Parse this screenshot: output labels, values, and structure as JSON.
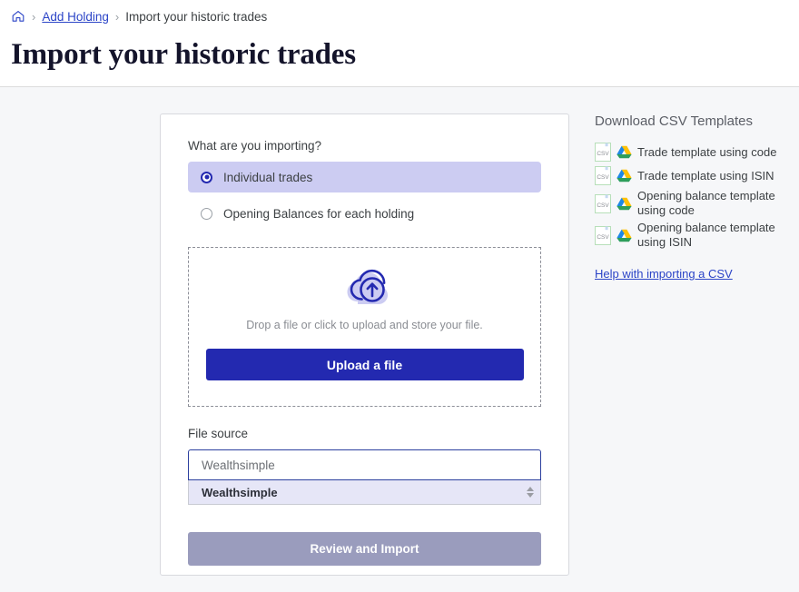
{
  "header": {
    "breadcrumb": {
      "home_icon": "home-icon",
      "separator": "›",
      "link": "Add Holding",
      "current": "Import your historic trades"
    },
    "title": "Import your historic trades"
  },
  "form": {
    "importing_label": "What are you importing?",
    "options": [
      {
        "label": "Individual trades",
        "selected": true
      },
      {
        "label": "Opening Balances for each holding",
        "selected": false
      }
    ],
    "dropzone": {
      "icon": "cloud-upload-icon",
      "text": "Drop a file or click to upload and store your file.",
      "button": "Upload a file"
    },
    "file_source": {
      "label": "File source",
      "value": "Wealthsimple",
      "placeholder": "File source",
      "suggestions": [
        "Wealthsimple"
      ]
    },
    "submit": "Review and Import"
  },
  "sidebar": {
    "title": "Download CSV Templates",
    "templates": [
      {
        "label": "Trade template using code",
        "file_icon": "csv-file-icon",
        "drive_icon": "google-drive-icon"
      },
      {
        "label": "Trade template using ISIN",
        "file_icon": "csv-file-icon",
        "drive_icon": "google-drive-icon"
      },
      {
        "label": "Opening balance template using code",
        "file_icon": "csv-file-icon",
        "drive_icon": "google-drive-icon"
      },
      {
        "label": "Opening balance template using ISIN",
        "file_icon": "csv-file-icon",
        "drive_icon": "google-drive-icon"
      }
    ],
    "help_link": "Help with importing a CSV"
  },
  "colors": {
    "primary": "#2329b0",
    "link": "#2b44c7",
    "selected_row": "#ccccf2",
    "disabled_button": "#9a9cbd",
    "page_background": "#f6f7f9"
  },
  "icon_labels": {
    "csv_text": "CSV"
  }
}
